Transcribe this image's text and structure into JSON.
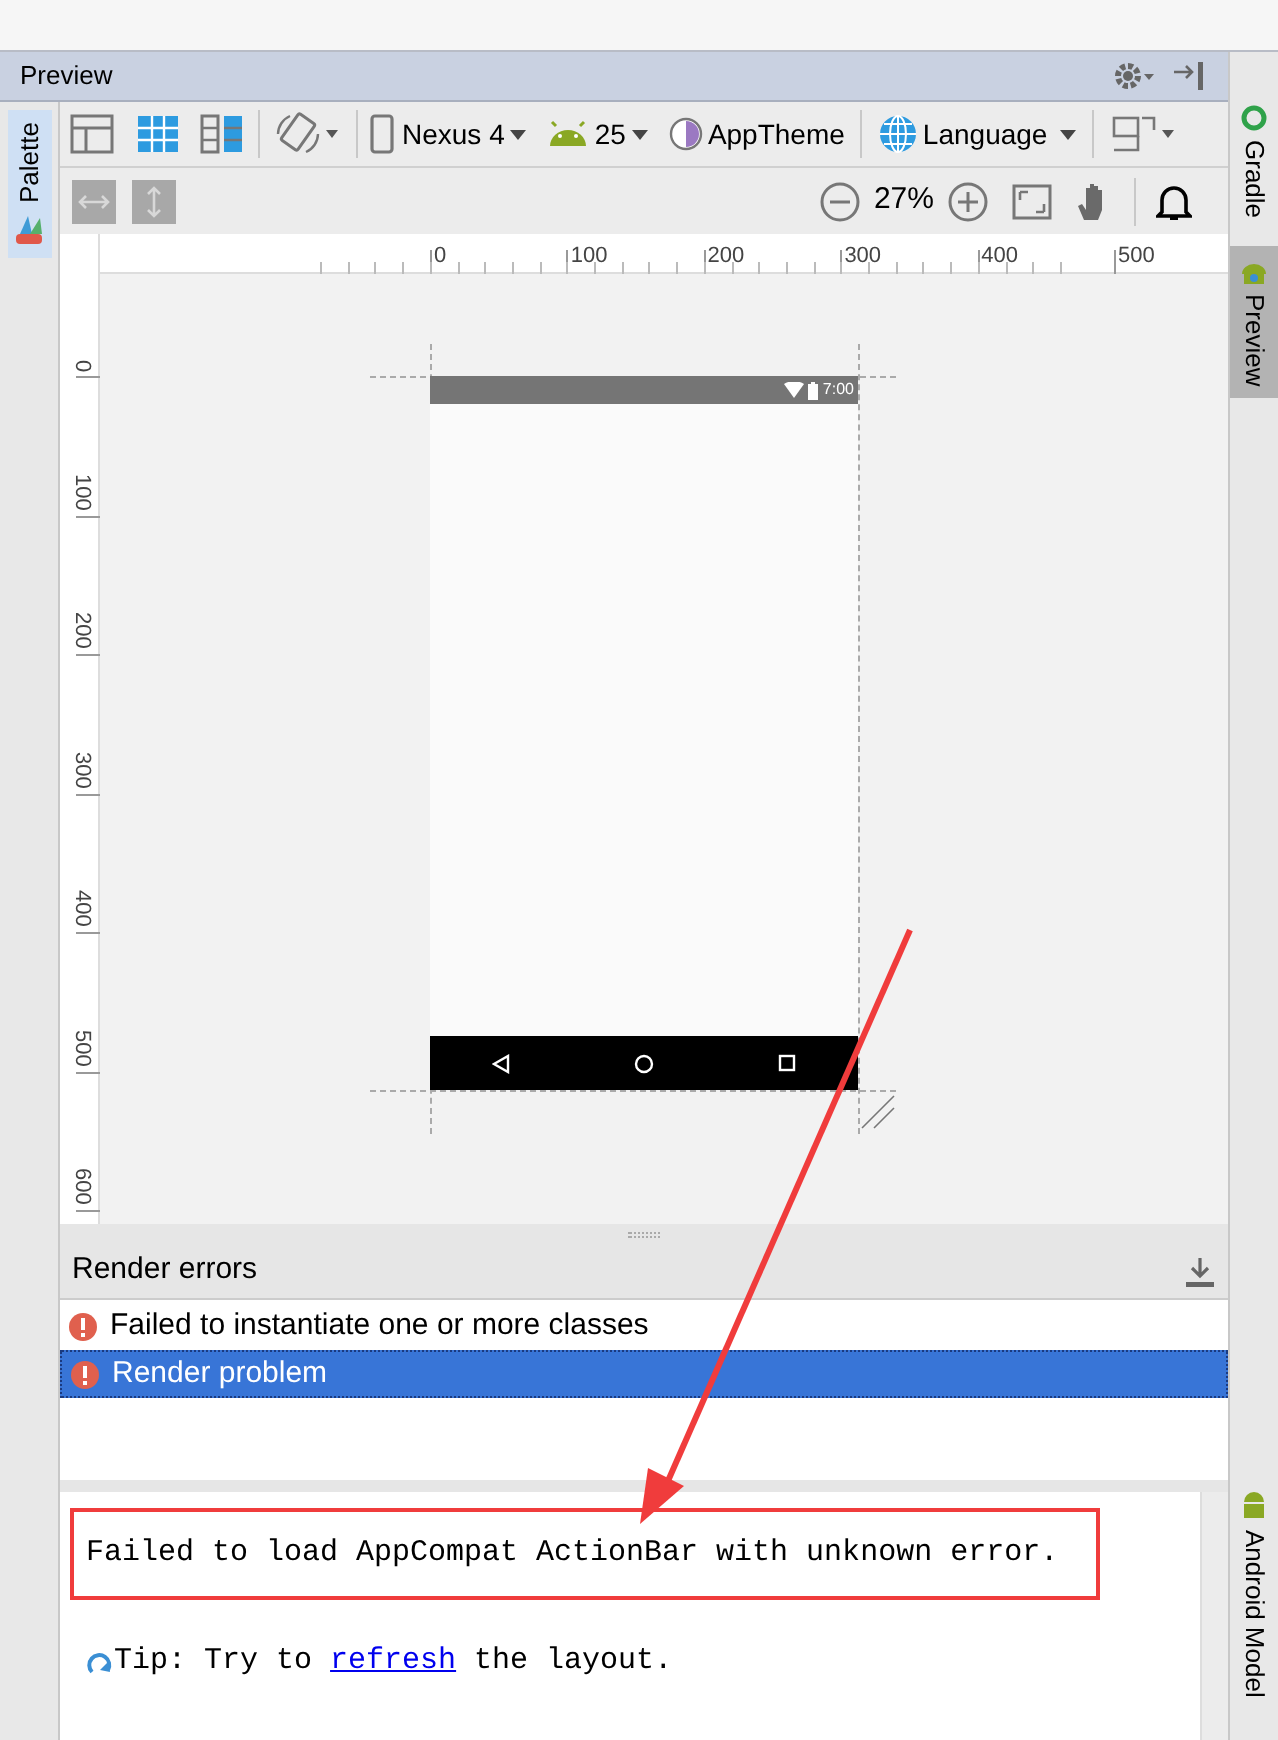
{
  "panel_title": "Preview",
  "left_tabs": [
    {
      "label": "Palette",
      "selected": true
    }
  ],
  "right_tabs": [
    {
      "label": "Gradle",
      "selected": false
    },
    {
      "label": "Preview",
      "selected": true
    },
    {
      "label": "Android Model",
      "selected": false
    }
  ],
  "toolbar": {
    "device": "Nexus 4",
    "api_level": "25",
    "theme": "AppTheme",
    "language": "Language",
    "zoom": "27%"
  },
  "ruler": {
    "x_labels": [
      "0",
      "100",
      "200",
      "300",
      "400",
      "500"
    ],
    "y_labels": [
      "0",
      "100",
      "200",
      "300",
      "400",
      "500",
      "600"
    ]
  },
  "device_preview": {
    "time": "7:00"
  },
  "render_errors": {
    "title": "Render errors",
    "items": [
      {
        "text": "Failed to instantiate one or more classes",
        "selected": false
      },
      {
        "text": "Render problem",
        "selected": true
      }
    ]
  },
  "message": {
    "text": "Failed to load AppCompat ActionBar with unknown error.",
    "tip_before": "Tip: Try to ",
    "link": "refresh",
    "tip_after": " the layout."
  }
}
